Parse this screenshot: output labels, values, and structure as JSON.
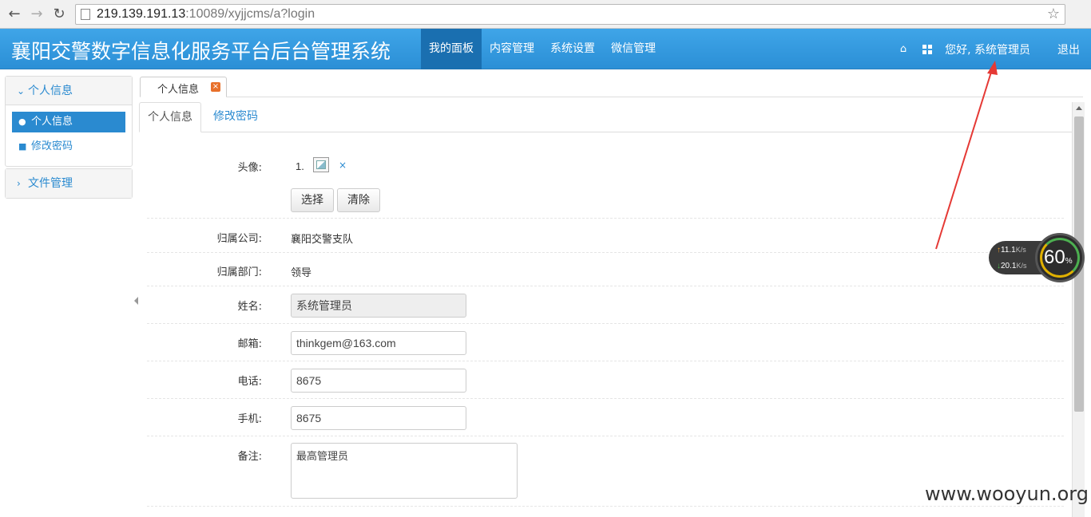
{
  "browser": {
    "back": "←",
    "forward": "→",
    "reload": "↻",
    "url_host": "219.139.191.13",
    "url_rest": ":10089/xyjjcms/a?login",
    "bookmark": "☆"
  },
  "header": {
    "brand": "襄阳交警数字信息化服务平台后台管理系统",
    "nav": [
      "我的面板",
      "内容管理",
      "系统设置",
      "微信管理"
    ],
    "greeting": "您好, 系统管理员",
    "logout": "退出",
    "home_icon": "⌂"
  },
  "sidebar": {
    "personal_title": "个人信息",
    "personal_items": [
      "个人信息",
      "修改密码"
    ],
    "file_title": "文件管理"
  },
  "tabs": {
    "outer_tab": "个人信息",
    "outer_close": "×",
    "inner_active": "个人信息",
    "inner_link": "修改密码"
  },
  "form": {
    "avatar_label": "头像:",
    "avatar_index": "1.",
    "avatar_delete": "×",
    "select_button": "选择",
    "clear_button": "清除",
    "company_label": "归属公司:",
    "company_value": "襄阳交警支队",
    "dept_label": "归属部门:",
    "dept_value": "领导",
    "name_label": "姓名:",
    "name_value": "系统管理员",
    "email_label": "邮箱:",
    "email_value": "thinkgem@163.com",
    "phone_label": "电话:",
    "phone_value": "8675",
    "mobile_label": "手机:",
    "mobile_value": "8675",
    "remarks_label": "备注:",
    "remarks_value": "最高管理员"
  },
  "netwidget": {
    "up": "11.1",
    "down": "20.1",
    "unit": "K/s",
    "percent": "60",
    "percent_sign": "%"
  },
  "watermark": "www.wooyun.org",
  "colors": {
    "header": "#2b8fd6",
    "active_nav": "#1a6fb0",
    "link": "#2a8ad0",
    "annotation": "#e53935"
  }
}
